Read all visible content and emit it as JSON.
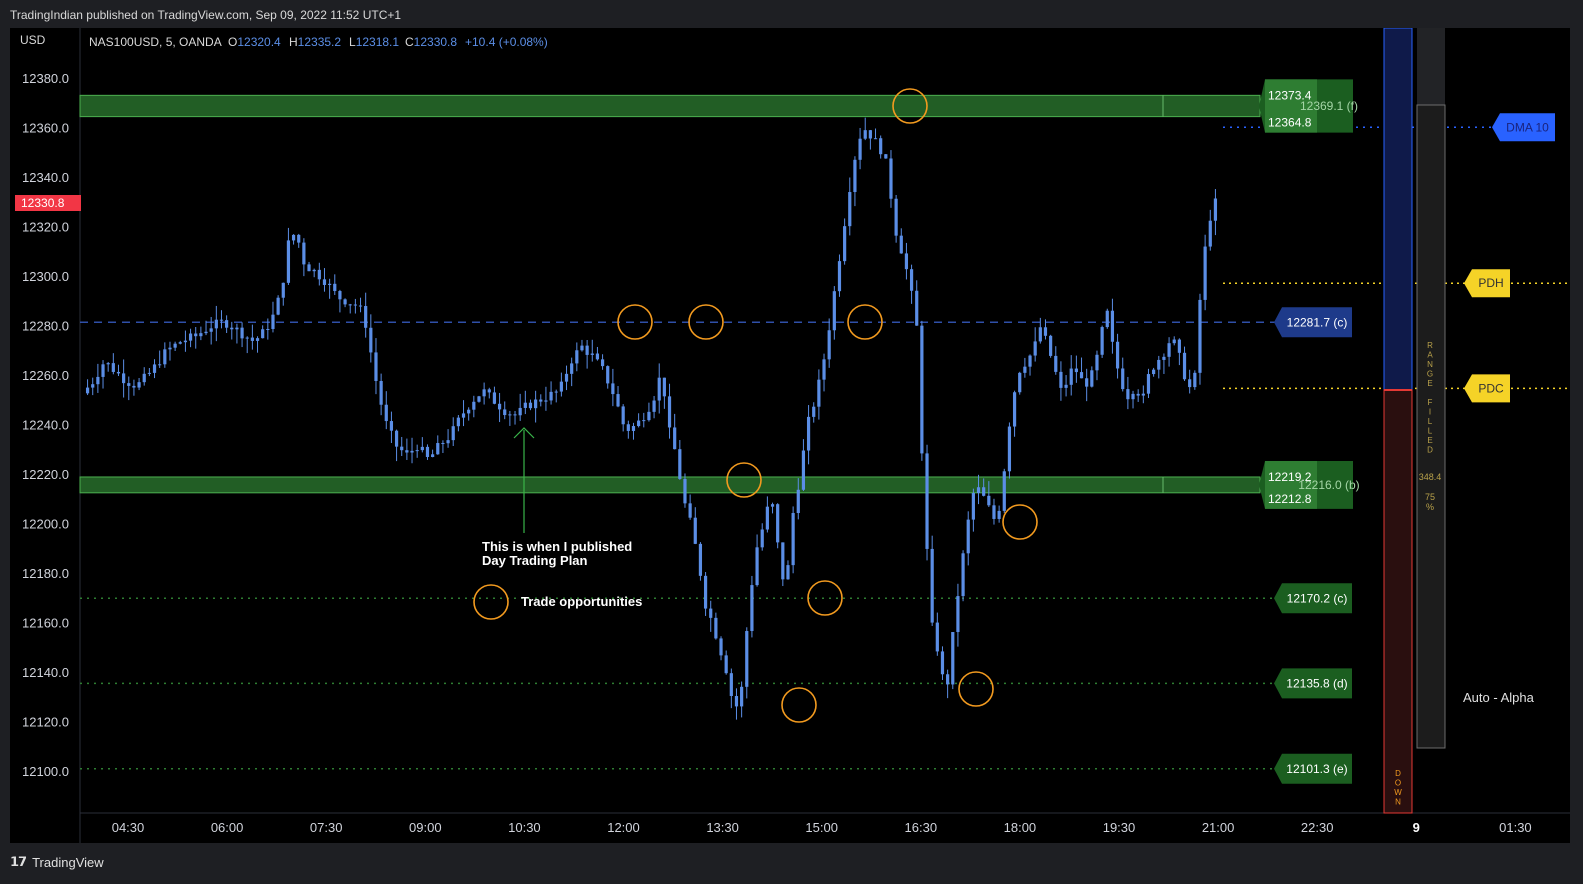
{
  "header": {
    "published": "TradingIndian published on TradingView.com, Sep 09, 2022 11:52 UTC+1"
  },
  "footer": {
    "brand": "TradingView"
  },
  "symbol": {
    "currency": "USD",
    "name": "NAS100USD, 5, OANDA",
    "o_label": "O",
    "o": "12320.4",
    "h_label": "H",
    "h": "12335.2",
    "l_label": "L",
    "l": "12318.1",
    "c_label": "C",
    "c": "12330.8",
    "change": "+10.4 (+0.08%)",
    "last_price": "12330.8"
  },
  "annotations": {
    "published_note": "This is when I published\nDay Trading Plan",
    "legend_circle": "Trade opportunities",
    "auto_alpha": "Auto - Alpha",
    "range_label": "RANGE FILLED",
    "range_value": "348.4",
    "range_pct": "75\n%",
    "down_label": "DOWN"
  },
  "chart_data": {
    "type": "candlestick",
    "ylim": [
      12090,
      12400
    ],
    "yticks": [
      12100,
      12120,
      12140,
      12160,
      12180,
      12200,
      12220,
      12240,
      12260,
      12280,
      12300,
      12320,
      12340,
      12360,
      12380
    ],
    "xticks": [
      "04:30",
      "06:00",
      "07:30",
      "09:00",
      "10:30",
      "12:00",
      "13:30",
      "15:00",
      "16:30",
      "18:00",
      "19:30",
      "21:00",
      "22:30",
      "9",
      "01:30"
    ],
    "zones": [
      {
        "name": "f",
        "top": 12373.4,
        "bottom": 12364.8,
        "label_top": "12373.4",
        "label_bottom": "12364.8",
        "label_mid": "12369.1 (f)"
      },
      {
        "name": "b",
        "top": 12219.2,
        "bottom": 12212.8,
        "label_top": "12219.2",
        "label_bottom": "12212.8",
        "label_mid": "12216.0 (b)"
      }
    ],
    "levels": [
      {
        "label": "12281.7 (c)",
        "value": 12281.7,
        "style": "dashed",
        "color": "#2f4fa8"
      },
      {
        "label": "12170.2 (c)",
        "value": 12170.2,
        "style": "dotted",
        "color": "#2e7d32"
      },
      {
        "label": "12135.8 (d)",
        "value": 12135.8,
        "style": "dotted",
        "color": "#2e7d32"
      },
      {
        "label": "12101.3 (e)",
        "value": 12101.3,
        "style": "dotted",
        "color": "#2e7d32"
      },
      {
        "label": "DMA 10",
        "value": 12360.5,
        "style": "dotted",
        "color": "#2962ff"
      },
      {
        "label": "PDH",
        "value": 12297.5,
        "style": "dotted",
        "color": "#f5d327"
      },
      {
        "label": "PDC",
        "value": 12255.0,
        "style": "dotted",
        "color": "#f5d327"
      }
    ],
    "candle_color": "#5b8ee6",
    "accent_colors": {
      "zone": "#2e7d32",
      "circle": "#f29a1f",
      "arrow": "#39b54a",
      "price_badge": "#f23645"
    }
  }
}
